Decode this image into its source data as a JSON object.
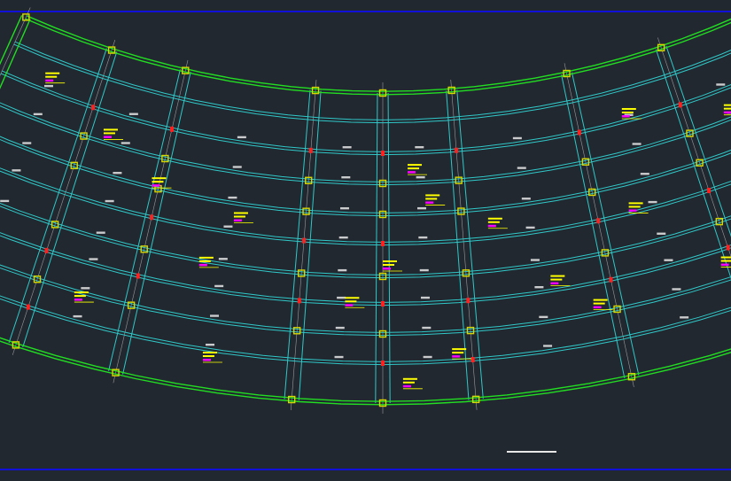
{
  "colors": {
    "background": "#212830",
    "frame": "#1010d8",
    "outer_beam": "#22dd22",
    "beam": "#30c8c8",
    "column": "#d8d800",
    "rebar_marker": "#ff2020",
    "tag_text": "#ffff00",
    "tag_highlight": "#ff00ff",
    "dim_text": "#ffffff",
    "grid": "#9a9a9a"
  },
  "icons": {
    "scale_bar": "scale-bar-line",
    "column": "square-column-marker"
  }
}
